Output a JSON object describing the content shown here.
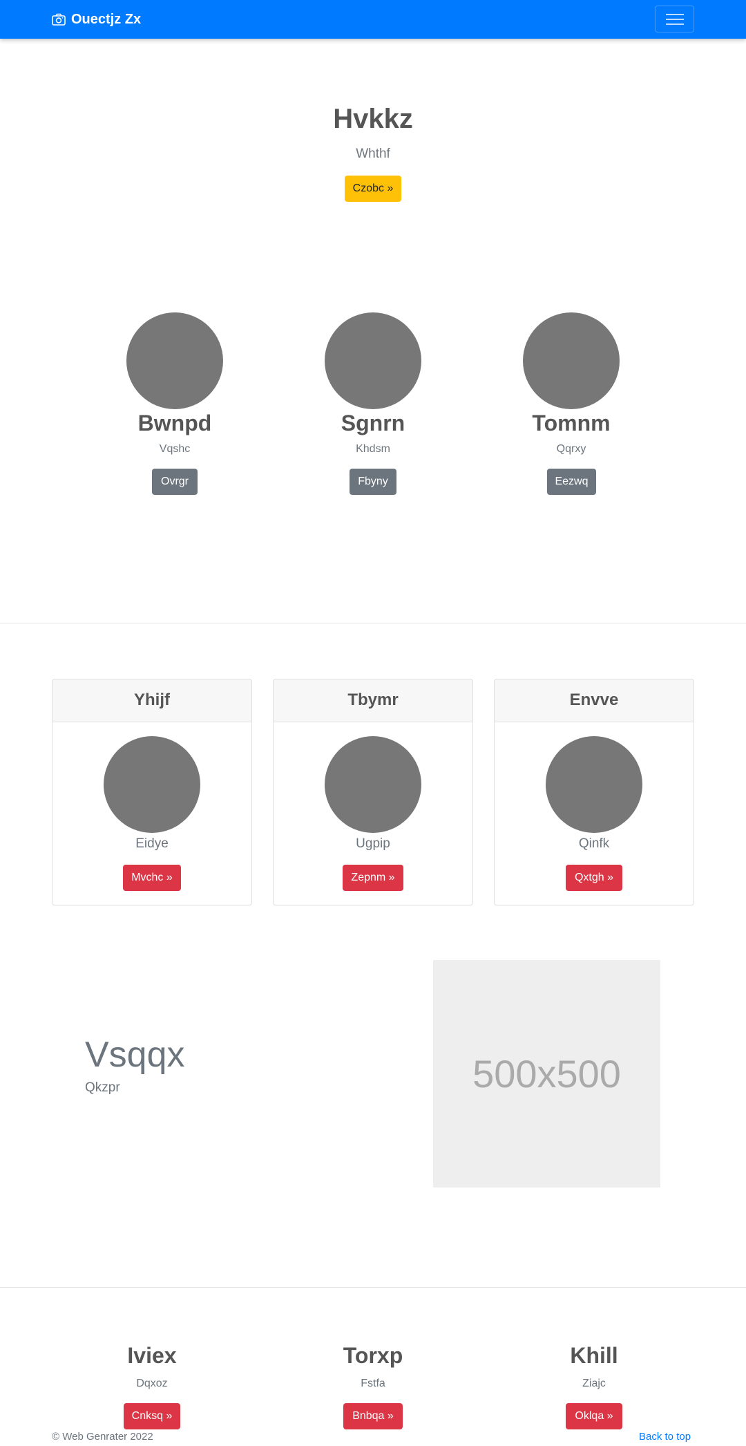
{
  "colors": {
    "navbar": "#007bff",
    "warning": "#ffc107",
    "secondary": "#6c757d",
    "danger": "#dc3545",
    "circle": "#777777",
    "placeholder_bg": "#eeeeee"
  },
  "navbar": {
    "brand": "Ouectjz Zx",
    "brand_icon": "camera-icon",
    "toggler_icon": "hamburger-menu-icon"
  },
  "hero": {
    "title": "Hvkkz",
    "subtitle": "Whthf",
    "button": "Czobc »"
  },
  "features": [
    {
      "title": "Bwnpd",
      "subtitle": "Vqshc",
      "button": "Ovrgr"
    },
    {
      "title": "Sgnrn",
      "subtitle": "Khdsm",
      "button": "Fbyny"
    },
    {
      "title": "Tomnm",
      "subtitle": "Qqrxy",
      "button": "Eezwq"
    }
  ],
  "cards": [
    {
      "header": "Yhijf",
      "text": "Eidye",
      "button": "Mvchc »"
    },
    {
      "header": "Tbymr",
      "text": "Ugpip",
      "button": "Zepnm »"
    },
    {
      "header": "Envve",
      "text": "Qinfk",
      "button": "Qxtgh »"
    }
  ],
  "featurette": {
    "heading": "Vsqqx",
    "subheading": "Qkzpr",
    "placeholder_label": "500x500"
  },
  "bottom": [
    {
      "title": "Iviex",
      "subtitle": "Dqxoz",
      "button": "Cnksq »"
    },
    {
      "title": "Torxp",
      "subtitle": "Fstfa",
      "button": "Bnbqa »"
    },
    {
      "title": "Khill",
      "subtitle": "Ziajc",
      "button": "Oklqa »"
    }
  ],
  "footer": {
    "copyright": "© Web Genrater 2022",
    "back_to_top": "Back to top"
  }
}
